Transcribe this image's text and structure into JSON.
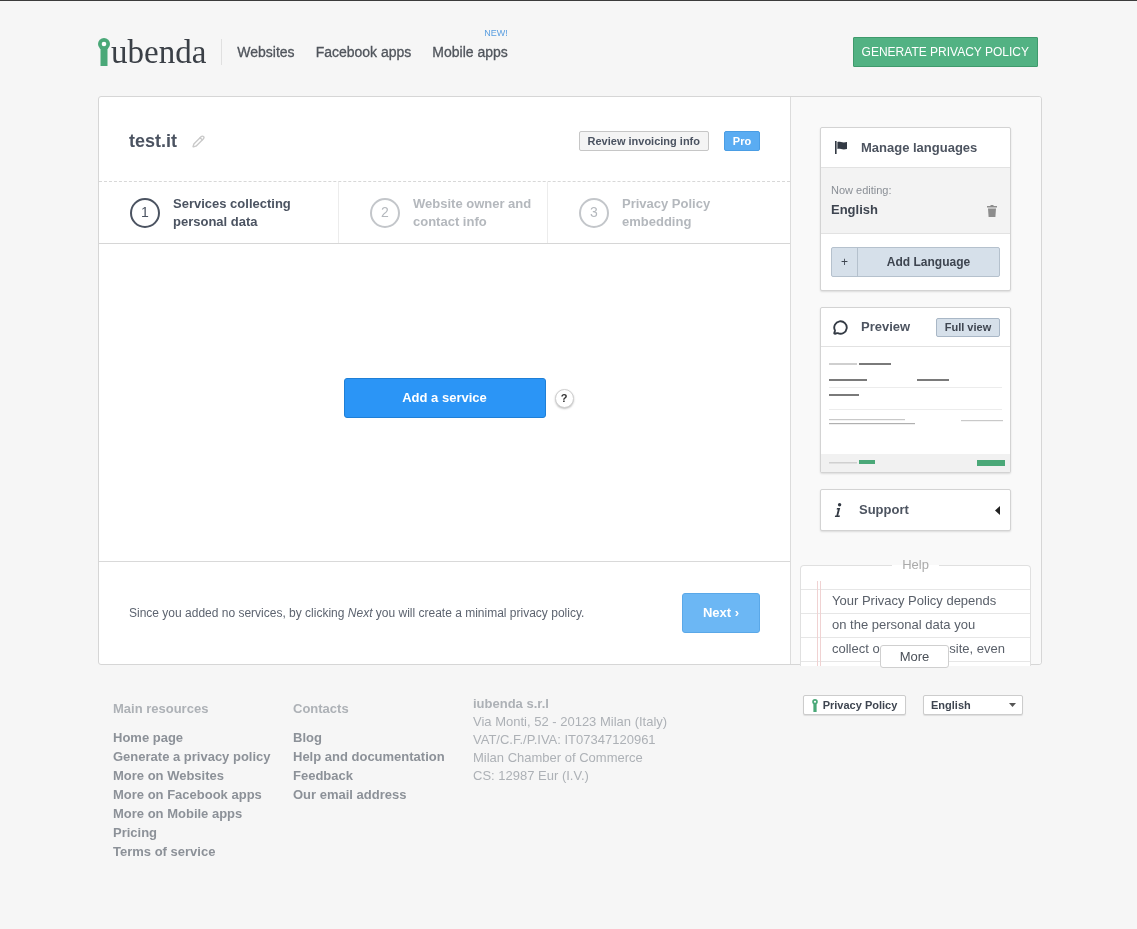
{
  "header": {
    "logo": {
      "text": "ubenda"
    },
    "nav": [
      {
        "label": "Websites"
      },
      {
        "label": "Facebook apps"
      },
      {
        "label": "Mobile apps",
        "badge": "NEW!"
      }
    ],
    "cta": "GENERATE PRIVACY POLICY"
  },
  "project": {
    "title": "test.it",
    "invoice_button": "Review invoicing info",
    "plan_badge": "Pro"
  },
  "steps": [
    {
      "number": "1",
      "label": "Services collecting personal data",
      "selected": true
    },
    {
      "number": "2",
      "label": "Website owner and contact info",
      "selected": false
    },
    {
      "number": "3",
      "label": "Privacy Policy embedding",
      "selected": false
    }
  ],
  "services": {
    "add_button": "Add a service",
    "help_button": "?"
  },
  "footer_note": {
    "text": "Since you added no services, by clicking *Next* you will create a minimal privacy policy.",
    "next_button": "Next ›"
  },
  "sidebar": {
    "languages": {
      "title": "Manage languages",
      "editing_label": "Now editing:",
      "current": "English",
      "add_button": {
        "icon": "+",
        "label": "Add Language"
      }
    },
    "preview": {
      "title": "Preview",
      "full_view_button": "Full view"
    },
    "support": {
      "title": "Support",
      "expanded": false
    },
    "help": {
      "title": "Help",
      "lines": [
        "Your Privacy Policy depends",
        "on the personal data you"
      ],
      "covered_line": {
        "left": "collect o",
        "right": "site, even"
      },
      "more_button": "More"
    }
  },
  "footer": {
    "columns": [
      {
        "heading": "Main resources",
        "links": [
          "Home page",
          "Generate a privacy policy",
          "More on Websites",
          "More on Facebook apps",
          "More on Mobile apps",
          "Pricing",
          "Terms of service"
        ]
      },
      {
        "heading": "Contacts",
        "links": [
          "Blog",
          "Help and documentation",
          "Feedback",
          "Our email address"
        ]
      }
    ],
    "company": {
      "name": "iubenda s.r.l",
      "lines": [
        "Via Monti, 52 - 20123 Milan (Italy)",
        "VAT/C.F./P.IVA: IT07347120961",
        "Milan Chamber of Commerce",
        "CS: 12987 Eur (I.V.)"
      ]
    },
    "privacy_button": "Privacy Policy",
    "language_select": "English"
  }
}
